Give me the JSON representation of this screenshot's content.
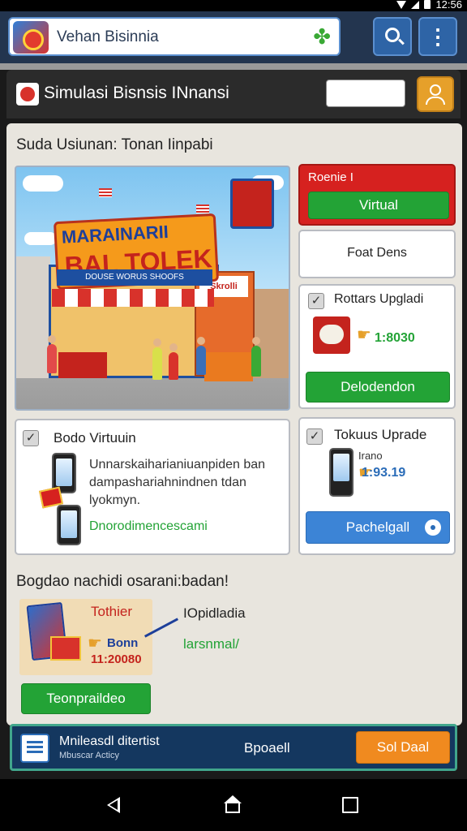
{
  "status_bar": {
    "time": "12:56"
  },
  "top_bar": {
    "url_text": "Vehan Bisinnia"
  },
  "title_bar": {
    "title": "Simulasi Bisnsis INnansi"
  },
  "main": {
    "section_title": "Suda Usiunan: Tonan Iinpabi",
    "hero": {
      "title_line1": "MARAINARII",
      "title_line2": "BAL TOLEK",
      "store_sign": "DOUSE WORUS SHOOFS",
      "shop_sign": "Skrolli"
    },
    "promo": {
      "label": "Roenie I",
      "button": "Virtual"
    },
    "float_card": {
      "label": "Foat Dens"
    },
    "upgrade_card": {
      "title": "Rottars Upgladi",
      "price": "1:8030",
      "button": "Delodendon"
    },
    "business_card": {
      "title": "Bodo Virtuuin",
      "description": "Unnarskaiharianiuanpiden ban dampashariahnindnen tdan lyokmyn.",
      "link": "Dnorodimencescami"
    },
    "token_card": {
      "title": "Tokuus Uprade",
      "small": "Irano",
      "price": "1:93.19",
      "button": "Pachelgall"
    },
    "section2_title": "Bogdao nachidi osarani:badan!",
    "package": {
      "label": "Tothier",
      "bonus": "Bonn",
      "price": "11:20080",
      "right_line1": "IOpidladia",
      "right_line2": "larsnmal/",
      "button": "Teonpraildeo"
    }
  },
  "bottom_bar": {
    "title": "Mnileasdl ditertist",
    "subtitle": "Mbuscar Acticy",
    "middle": "Bpoaell",
    "button": "Sol Daal"
  },
  "colors": {
    "header_bg": "#23354f",
    "accent_blue": "#2e64a6",
    "green": "#23a336",
    "red": "#d6211f",
    "orange": "#f08a1f",
    "bottom_bar": "#14375f"
  }
}
